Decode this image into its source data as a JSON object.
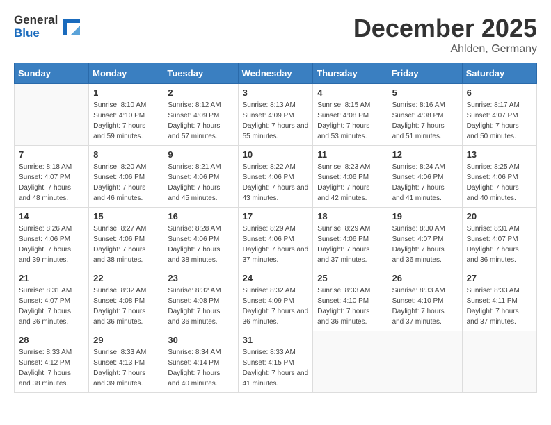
{
  "header": {
    "logo_general": "General",
    "logo_blue": "Blue",
    "month_year": "December 2025",
    "location": "Ahlden, Germany"
  },
  "weekdays": [
    "Sunday",
    "Monday",
    "Tuesday",
    "Wednesday",
    "Thursday",
    "Friday",
    "Saturday"
  ],
  "weeks": [
    [
      {
        "day": "",
        "sunrise": "",
        "sunset": "",
        "daylight": ""
      },
      {
        "day": "1",
        "sunrise": "Sunrise: 8:10 AM",
        "sunset": "Sunset: 4:10 PM",
        "daylight": "Daylight: 7 hours and 59 minutes."
      },
      {
        "day": "2",
        "sunrise": "Sunrise: 8:12 AM",
        "sunset": "Sunset: 4:09 PM",
        "daylight": "Daylight: 7 hours and 57 minutes."
      },
      {
        "day": "3",
        "sunrise": "Sunrise: 8:13 AM",
        "sunset": "Sunset: 4:09 PM",
        "daylight": "Daylight: 7 hours and 55 minutes."
      },
      {
        "day": "4",
        "sunrise": "Sunrise: 8:15 AM",
        "sunset": "Sunset: 4:08 PM",
        "daylight": "Daylight: 7 hours and 53 minutes."
      },
      {
        "day": "5",
        "sunrise": "Sunrise: 8:16 AM",
        "sunset": "Sunset: 4:08 PM",
        "daylight": "Daylight: 7 hours and 51 minutes."
      },
      {
        "day": "6",
        "sunrise": "Sunrise: 8:17 AM",
        "sunset": "Sunset: 4:07 PM",
        "daylight": "Daylight: 7 hours and 50 minutes."
      }
    ],
    [
      {
        "day": "7",
        "sunrise": "Sunrise: 8:18 AM",
        "sunset": "Sunset: 4:07 PM",
        "daylight": "Daylight: 7 hours and 48 minutes."
      },
      {
        "day": "8",
        "sunrise": "Sunrise: 8:20 AM",
        "sunset": "Sunset: 4:06 PM",
        "daylight": "Daylight: 7 hours and 46 minutes."
      },
      {
        "day": "9",
        "sunrise": "Sunrise: 8:21 AM",
        "sunset": "Sunset: 4:06 PM",
        "daylight": "Daylight: 7 hours and 45 minutes."
      },
      {
        "day": "10",
        "sunrise": "Sunrise: 8:22 AM",
        "sunset": "Sunset: 4:06 PM",
        "daylight": "Daylight: 7 hours and 43 minutes."
      },
      {
        "day": "11",
        "sunrise": "Sunrise: 8:23 AM",
        "sunset": "Sunset: 4:06 PM",
        "daylight": "Daylight: 7 hours and 42 minutes."
      },
      {
        "day": "12",
        "sunrise": "Sunrise: 8:24 AM",
        "sunset": "Sunset: 4:06 PM",
        "daylight": "Daylight: 7 hours and 41 minutes."
      },
      {
        "day": "13",
        "sunrise": "Sunrise: 8:25 AM",
        "sunset": "Sunset: 4:06 PM",
        "daylight": "Daylight: 7 hours and 40 minutes."
      }
    ],
    [
      {
        "day": "14",
        "sunrise": "Sunrise: 8:26 AM",
        "sunset": "Sunset: 4:06 PM",
        "daylight": "Daylight: 7 hours and 39 minutes."
      },
      {
        "day": "15",
        "sunrise": "Sunrise: 8:27 AM",
        "sunset": "Sunset: 4:06 PM",
        "daylight": "Daylight: 7 hours and 38 minutes."
      },
      {
        "day": "16",
        "sunrise": "Sunrise: 8:28 AM",
        "sunset": "Sunset: 4:06 PM",
        "daylight": "Daylight: 7 hours and 38 minutes."
      },
      {
        "day": "17",
        "sunrise": "Sunrise: 8:29 AM",
        "sunset": "Sunset: 4:06 PM",
        "daylight": "Daylight: 7 hours and 37 minutes."
      },
      {
        "day": "18",
        "sunrise": "Sunrise: 8:29 AM",
        "sunset": "Sunset: 4:06 PM",
        "daylight": "Daylight: 7 hours and 37 minutes."
      },
      {
        "day": "19",
        "sunrise": "Sunrise: 8:30 AM",
        "sunset": "Sunset: 4:07 PM",
        "daylight": "Daylight: 7 hours and 36 minutes."
      },
      {
        "day": "20",
        "sunrise": "Sunrise: 8:31 AM",
        "sunset": "Sunset: 4:07 PM",
        "daylight": "Daylight: 7 hours and 36 minutes."
      }
    ],
    [
      {
        "day": "21",
        "sunrise": "Sunrise: 8:31 AM",
        "sunset": "Sunset: 4:07 PM",
        "daylight": "Daylight: 7 hours and 36 minutes."
      },
      {
        "day": "22",
        "sunrise": "Sunrise: 8:32 AM",
        "sunset": "Sunset: 4:08 PM",
        "daylight": "Daylight: 7 hours and 36 minutes."
      },
      {
        "day": "23",
        "sunrise": "Sunrise: 8:32 AM",
        "sunset": "Sunset: 4:08 PM",
        "daylight": "Daylight: 7 hours and 36 minutes."
      },
      {
        "day": "24",
        "sunrise": "Sunrise: 8:32 AM",
        "sunset": "Sunset: 4:09 PM",
        "daylight": "Daylight: 7 hours and 36 minutes."
      },
      {
        "day": "25",
        "sunrise": "Sunrise: 8:33 AM",
        "sunset": "Sunset: 4:10 PM",
        "daylight": "Daylight: 7 hours and 36 minutes."
      },
      {
        "day": "26",
        "sunrise": "Sunrise: 8:33 AM",
        "sunset": "Sunset: 4:10 PM",
        "daylight": "Daylight: 7 hours and 37 minutes."
      },
      {
        "day": "27",
        "sunrise": "Sunrise: 8:33 AM",
        "sunset": "Sunset: 4:11 PM",
        "daylight": "Daylight: 7 hours and 37 minutes."
      }
    ],
    [
      {
        "day": "28",
        "sunrise": "Sunrise: 8:33 AM",
        "sunset": "Sunset: 4:12 PM",
        "daylight": "Daylight: 7 hours and 38 minutes."
      },
      {
        "day": "29",
        "sunrise": "Sunrise: 8:33 AM",
        "sunset": "Sunset: 4:13 PM",
        "daylight": "Daylight: 7 hours and 39 minutes."
      },
      {
        "day": "30",
        "sunrise": "Sunrise: 8:34 AM",
        "sunset": "Sunset: 4:14 PM",
        "daylight": "Daylight: 7 hours and 40 minutes."
      },
      {
        "day": "31",
        "sunrise": "Sunrise: 8:33 AM",
        "sunset": "Sunset: 4:15 PM",
        "daylight": "Daylight: 7 hours and 41 minutes."
      },
      {
        "day": "",
        "sunrise": "",
        "sunset": "",
        "daylight": ""
      },
      {
        "day": "",
        "sunrise": "",
        "sunset": "",
        "daylight": ""
      },
      {
        "day": "",
        "sunrise": "",
        "sunset": "",
        "daylight": ""
      }
    ]
  ]
}
